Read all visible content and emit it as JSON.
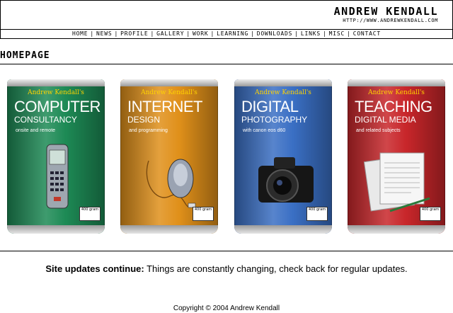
{
  "site": {
    "name": "ANDREW KENDALL",
    "url": "HTTP://WWW.ANDREWKENDALL.COM"
  },
  "nav": [
    {
      "label": "HOME"
    },
    {
      "label": "NEWS"
    },
    {
      "label": "PROFILE"
    },
    {
      "label": "GALLERY"
    },
    {
      "label": "WORK"
    },
    {
      "label": "LEARNING"
    },
    {
      "label": "DOWNLOADS"
    },
    {
      "label": "LINKS"
    },
    {
      "label": "MISC"
    },
    {
      "label": "CONTACT"
    }
  ],
  "page_title": "HOMEPAGE",
  "cans": [
    {
      "brand": "Andrew Kendall's",
      "big": "COMPUTER",
      "small": "CONSULTANCY",
      "tiny": "onsite and remote",
      "color": "#1d8a55",
      "art": "mobile-phone",
      "label": "400 gram"
    },
    {
      "brand": "Andrew Kendall's",
      "big": "INTERNET",
      "small": "DESIGN",
      "tiny": "and programming",
      "color": "#e0901a",
      "art": "computer-mouse",
      "label": "400 gram"
    },
    {
      "brand": "Andrew Kendall's",
      "big": "DIGITAL",
      "small": "PHOTOGRAPHY",
      "tiny": "with canon eos d60",
      "color": "#3a6fc4",
      "art": "camera",
      "label": "400 gram"
    },
    {
      "brand": "Andrew Kendall's",
      "big": "TEACHING",
      "small": "DIGITAL MEDIA",
      "tiny": "and related subjects",
      "color": "#c8262a",
      "art": "papers",
      "label": "400 gram"
    }
  ],
  "updates": {
    "heading": "Site updates continue:",
    "text": " Things are constantly changing, check back for regular updates."
  },
  "footer": "Copyright © 2004 Andrew Kendall"
}
